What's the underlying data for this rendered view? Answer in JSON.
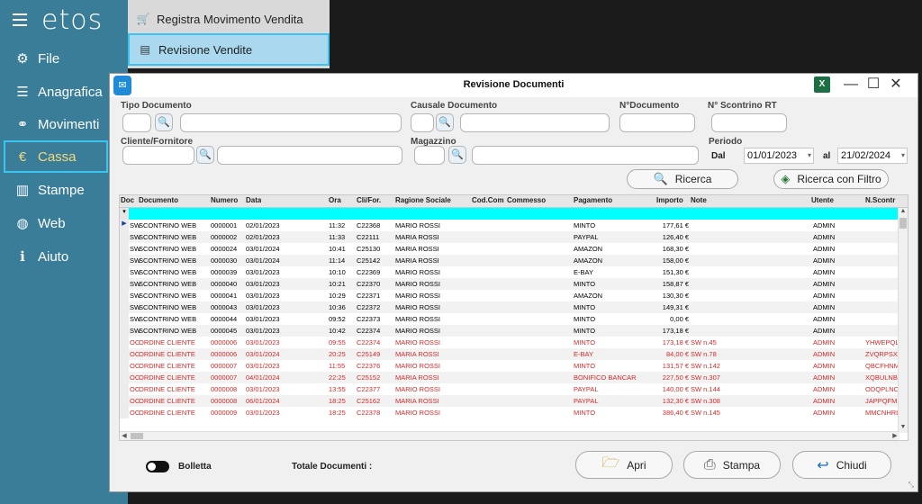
{
  "app": {
    "logo": "etos"
  },
  "sidebar": {
    "items": [
      {
        "label": "File",
        "icon": "⚙"
      },
      {
        "label": "Anagrafica",
        "icon": "☰"
      },
      {
        "label": "Movimenti",
        "icon": "⚭"
      },
      {
        "label": "Cassa",
        "icon": "€"
      },
      {
        "label": "Stampe",
        "icon": "▥"
      },
      {
        "label": "Web",
        "icon": "◍"
      },
      {
        "label": "Aiuto",
        "icon": "ℹ"
      }
    ]
  },
  "submenu": {
    "items": [
      {
        "label": "Registra Movimento Vendita",
        "icon": "🛒"
      },
      {
        "label": "Revisione Vendite",
        "icon": "▤"
      }
    ]
  },
  "window": {
    "title": "Revisione Documenti",
    "excel_icon": "X",
    "minimize": "—",
    "maximize": "☐",
    "close": "✕"
  },
  "filters": {
    "tipo_documento": "Tipo Documento",
    "causale_documento": "Causale Documento",
    "n_documento": "N°Documento",
    "n_scontrino": "N° Scontrino RT",
    "cliente_fornitore": "Cliente/Fornitore",
    "magazzino": "Magazzino",
    "periodo": "Periodo",
    "dal_label": "Dal",
    "dal_value": "01/01/2023",
    "al_label": "al",
    "al_value": "21/02/2024",
    "ricerca": "Ricerca",
    "ricerca_filtro": "Ricerca con Filtro"
  },
  "grid": {
    "columns": [
      "Doc",
      "Documento",
      "Numero",
      "Data",
      "Ora",
      "Cli/For.",
      "Ragione Sociale",
      "Cod.Com",
      "Commesso",
      "Pagamento",
      "Importo",
      "Note",
      "Utente",
      "N.Scontr"
    ],
    "rows": [
      [
        "SW",
        "SCONTRINO WEB",
        "0000001",
        "02/01/2023",
        "11:32",
        "C22368",
        "MARIO ROSSI",
        "",
        "",
        "MINTO",
        "177,61 €",
        "",
        "ADMIN",
        ""
      ],
      [
        "SW",
        "SCONTRINO WEB",
        "0000002",
        "02/01/2023",
        "11:33",
        "C22111",
        "MARIA ROSSI",
        "",
        "",
        "PAYPAL",
        "126,40 €",
        "",
        "ADMIN",
        ""
      ],
      [
        "SW",
        "SCONTRINO WEB",
        "0000024",
        "03/01/2024",
        "10:41",
        "C25130",
        "MARIA ROSSI",
        "",
        "",
        "AMAZON",
        "168,30 €",
        "",
        "ADMIN",
        ""
      ],
      [
        "SW",
        "SCONTRINO WEB",
        "0000030",
        "03/01/2024",
        "11:14",
        "C25142",
        "MARIA ROSSI",
        "",
        "",
        "AMAZON",
        "158,00 €",
        "",
        "ADMIN",
        ""
      ],
      [
        "SW",
        "SCONTRINO WEB",
        "0000039",
        "03/01/2023",
        "10:10",
        "C22369",
        "MARIO ROSSI",
        "",
        "",
        "E-BAY",
        "151,30 €",
        "",
        "ADMIN",
        ""
      ],
      [
        "SW",
        "SCONTRINO WEB",
        "0000040",
        "03/01/2023",
        "10:21",
        "C22370",
        "MARIO ROSSI",
        "",
        "",
        "MINTO",
        "158,87 €",
        "",
        "ADMIN",
        ""
      ],
      [
        "SW",
        "SCONTRINO WEB",
        "0000041",
        "03/01/2023",
        "10:29",
        "C22371",
        "MARIO ROSSI",
        "",
        "",
        "AMAZON",
        "130,30 €",
        "",
        "ADMIN",
        ""
      ],
      [
        "SW",
        "SCONTRINO WEB",
        "0000043",
        "03/01/2023",
        "10:36",
        "C22372",
        "MARIO ROSSI",
        "",
        "",
        "MINTO",
        "149,31 €",
        "",
        "ADMIN",
        ""
      ],
      [
        "SW",
        "SCONTRINO WEB",
        "0000044",
        "03/01/2023",
        "09:52",
        "C22373",
        "MARIO ROSSI",
        "",
        "",
        "MINTO",
        "0,00 €",
        "",
        "ADMIN",
        ""
      ],
      [
        "SW",
        "SCONTRINO WEB",
        "0000045",
        "03/01/2023",
        "10:42",
        "C22374",
        "MARIO ROSSI",
        "",
        "",
        "MINTO",
        "173,18 €",
        "",
        "ADMIN",
        ""
      ],
      [
        "OC",
        "ORDINE CLIENTE",
        "0000006",
        "03/01/2023",
        "09:55",
        "C22374",
        "MARIO ROSSI",
        "",
        "",
        "MINTO",
        "173,18 €",
        "SW n.45",
        "ADMIN",
        "YHWEPQL"
      ],
      [
        "OC",
        "ORDINE CLIENTE",
        "0000006",
        "03/01/2024",
        "20:25",
        "C25149",
        "MARIA ROSSI",
        "",
        "",
        "E-BAY",
        "84,00 €",
        "SW n.78",
        "ADMIN",
        "ZVQRPSX"
      ],
      [
        "OC",
        "ORDINE CLIENTE",
        "0000007",
        "03/01/2023",
        "11:55",
        "C22376",
        "MARIO ROSSI",
        "",
        "",
        "MINTO",
        "131,57 €",
        "SW n.142",
        "ADMIN",
        "QBCFHNM"
      ],
      [
        "OC",
        "ORDINE CLIENTE",
        "0000007",
        "04/01/2024",
        "22:25",
        "C25152",
        "MARIA ROSSI",
        "",
        "",
        "BONIFICO BANCAR",
        "227,50 €",
        "SW n.307",
        "ADMIN",
        "XQBULNB"
      ],
      [
        "OC",
        "ORDINE CLIENTE",
        "0000008",
        "03/01/2023",
        "13:55",
        "C22377",
        "MARIO ROSSI",
        "",
        "",
        "PAYPAL",
        "140,00 €",
        "SW n.144",
        "ADMIN",
        "ODQPLNC"
      ],
      [
        "OC",
        "ORDINE CLIENTE",
        "0000008",
        "06/01/2024",
        "18:25",
        "C25162",
        "MARIA ROSSI",
        "",
        "",
        "PAYPAL",
        "132,30 €",
        "SW n.308",
        "ADMIN",
        "JAPPQFM"
      ],
      [
        "OC",
        "ORDINE CLIENTE",
        "0000009",
        "03/01/2023",
        "18:25",
        "C22378",
        "MARIO ROSSI",
        "",
        "",
        "MINTO",
        "386,40 €",
        "SW n.145",
        "ADMIN",
        "MMCNHRL"
      ]
    ]
  },
  "footer": {
    "bolletta": "Bolletta",
    "totale": "Totale Documenti :",
    "apri": "Apri",
    "stampa": "Stampa",
    "chiudi": "Chiudi"
  }
}
